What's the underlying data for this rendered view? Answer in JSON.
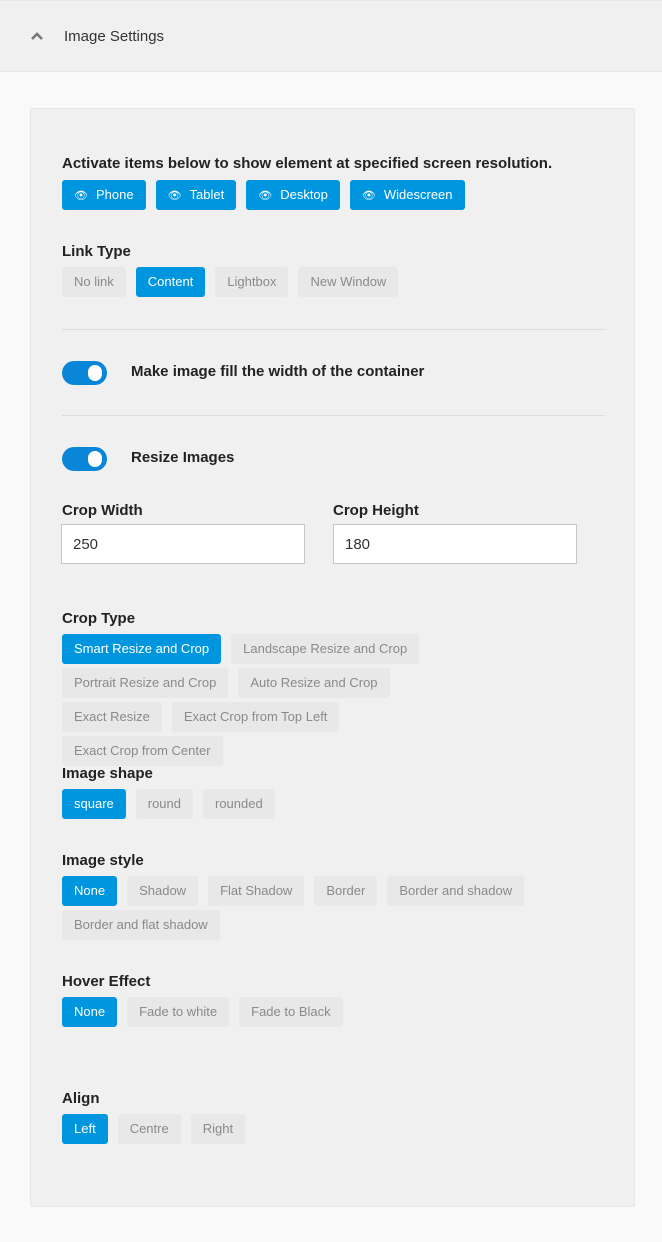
{
  "header": {
    "title": "Image Settings",
    "icon": "chevron-up-icon"
  },
  "visibility": {
    "intro": "Activate items below to show element at specified screen resolution.",
    "buttons": [
      {
        "label": "Phone",
        "icon": "eye-icon",
        "active": true
      },
      {
        "label": "Tablet",
        "icon": "eye-icon",
        "active": true
      },
      {
        "label": "Desktop",
        "icon": "eye-icon",
        "active": true
      },
      {
        "label": "Widescreen",
        "icon": "eye-icon",
        "active": true
      }
    ]
  },
  "link_type": {
    "label": "Link Type",
    "options": [
      "No link",
      "Content",
      "Lightbox",
      "New Window"
    ],
    "selected": "Content"
  },
  "fill_width": {
    "label": "Make image fill the width of the container",
    "on": true
  },
  "resize": {
    "label": "Resize Images",
    "on": true
  },
  "crop_width": {
    "label": "Crop Width",
    "value": "250"
  },
  "crop_height": {
    "label": "Crop Height",
    "value": "180"
  },
  "crop_type": {
    "label": "Crop Type",
    "options": [
      "Smart Resize and Crop",
      "Landscape Resize and Crop",
      "Portrait Resize and Crop",
      "Auto Resize and Crop",
      "Exact Resize",
      "Exact Crop from Top Left",
      "Exact Crop from Center"
    ],
    "selected": "Smart Resize and Crop"
  },
  "image_shape": {
    "label": "Image shape",
    "options": [
      "square",
      "round",
      "rounded"
    ],
    "selected": "square"
  },
  "image_style": {
    "label": "Image style",
    "options": [
      "None",
      "Shadow",
      "Flat Shadow",
      "Border",
      "Border and shadow",
      "Border and flat shadow"
    ],
    "selected": "None"
  },
  "hover_effect": {
    "label": "Hover Effect",
    "options": [
      "None",
      "Fade to white",
      "Fade to Black"
    ],
    "selected": "None"
  },
  "align": {
    "label": "Align",
    "options": [
      "Left",
      "Centre",
      "Right"
    ],
    "selected": "Left"
  },
  "colors": {
    "accent": "#0096df",
    "toggle": "#0a86d8",
    "inactive_bg": "#e8e8e8",
    "inactive_text": "#8a8a8a"
  }
}
